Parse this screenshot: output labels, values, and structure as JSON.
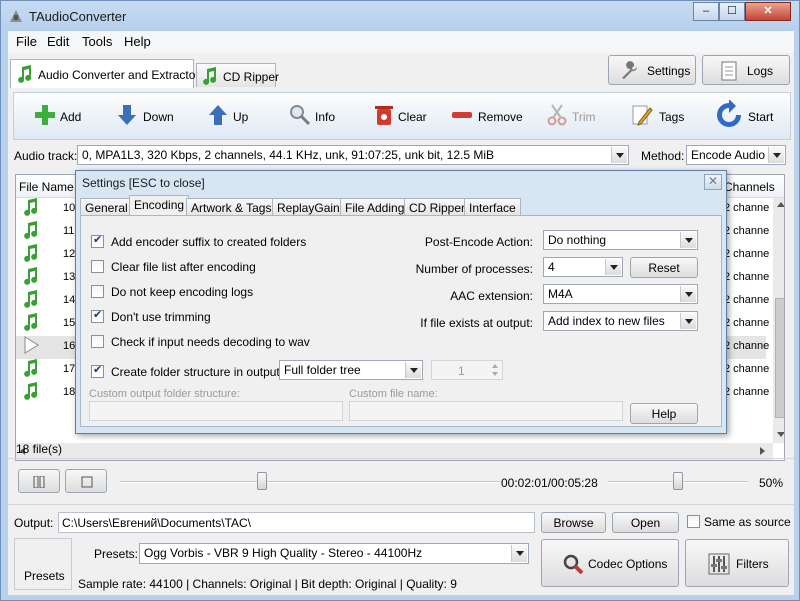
{
  "window": {
    "title": "TAudioConverter",
    "min": "–",
    "max": "☐",
    "close": "✕"
  },
  "menu": [
    "File",
    "Edit",
    "Tools",
    "Help"
  ],
  "main_tabs": [
    {
      "label": "Audio Converter and Extractor",
      "active": true
    },
    {
      "label": "CD Ripper",
      "active": false
    }
  ],
  "top_buttons": {
    "settings": "Settings",
    "logs": "Logs"
  },
  "toolbar": {
    "add": "Add",
    "down": "Down",
    "up": "Up",
    "info": "Info",
    "clear": "Clear",
    "remove": "Remove",
    "trim": "Trim",
    "tags": "Tags",
    "start": "Start"
  },
  "audio_track": {
    "label": "Audio track:",
    "value": "0, MPA1L3, 320 Kbps, 2 channels, 44.1 KHz, unk, 91:07:25, unk bit, 12.5 MiB"
  },
  "method": {
    "label": "Method:",
    "value": "Encode Audio"
  },
  "list": {
    "header": {
      "file_name": "File Name",
      "channels": "Channels"
    },
    "rows": [
      {
        "num": "10",
        "channels": "2 channe"
      },
      {
        "num": "11",
        "channels": "2 channe"
      },
      {
        "num": "12",
        "channels": "2 channe"
      },
      {
        "num": "13",
        "channels": "2 channe"
      },
      {
        "num": "14",
        "channels": "2 channe"
      },
      {
        "num": "15",
        "channels": "2 channe"
      },
      {
        "num": "16",
        "channels": "2 channe",
        "playing": true
      },
      {
        "num": "17",
        "channels": "2 channe"
      },
      {
        "num": "18",
        "channels": "2 channe"
      }
    ]
  },
  "dialog": {
    "title": "Settings [ESC to close]",
    "close": "✕",
    "tabs": [
      "General",
      "Encoding",
      "Artwork & Tags",
      "ReplayGain",
      "File Adding",
      "CD Ripper",
      "Interface"
    ],
    "active_tab": "Encoding",
    "checks": {
      "add_suffix": "Add encoder suffix to created folders",
      "clear_list": "Clear file list after encoding",
      "no_logs": "Do not keep encoding logs",
      "no_trim": "Don't use trimming",
      "check_input": "Check if input needs decoding to wav",
      "folder_structure": "Create folder structure in output"
    },
    "check_states": {
      "add_suffix": true,
      "clear_list": false,
      "no_logs": false,
      "no_trim": true,
      "check_input": false,
      "folder_structure": true
    },
    "folder_tree": "Full folder tree",
    "spin_value": "1",
    "custom_folder_label": "Custom output folder structure:",
    "custom_file_label": "Custom file name:",
    "post_encode": {
      "label": "Post-Encode Action:",
      "value": "Do nothing"
    },
    "processes": {
      "label": "Number of processes:",
      "value": "4"
    },
    "reset": "Reset",
    "aac": {
      "label": "AAC extension:",
      "value": "M4A"
    },
    "if_exists": {
      "label": "If file exists at output:",
      "value": "Add index to new files"
    },
    "help": "Help"
  },
  "file_count": "18 file(s)",
  "player": {
    "time": "00:02:01/00:05:28",
    "volume": "50%",
    "progress": 0.37,
    "volume_level": 0.5
  },
  "output": {
    "label": "Output:",
    "path": "C:\\Users\\Евгений\\Documents\\TAC\\",
    "browse": "Browse",
    "open": "Open",
    "same_as_source": "Same as source"
  },
  "presets": {
    "button": "Presets",
    "label": "Presets:",
    "value": "Ogg Vorbis - VBR 9 High Quality - Stereo - 44100Hz",
    "info": "Sample rate: 44100 | Channels: Original | Bit depth: Original | Quality: 9",
    "codec_options": "Codec Options",
    "filters": "Filters"
  }
}
